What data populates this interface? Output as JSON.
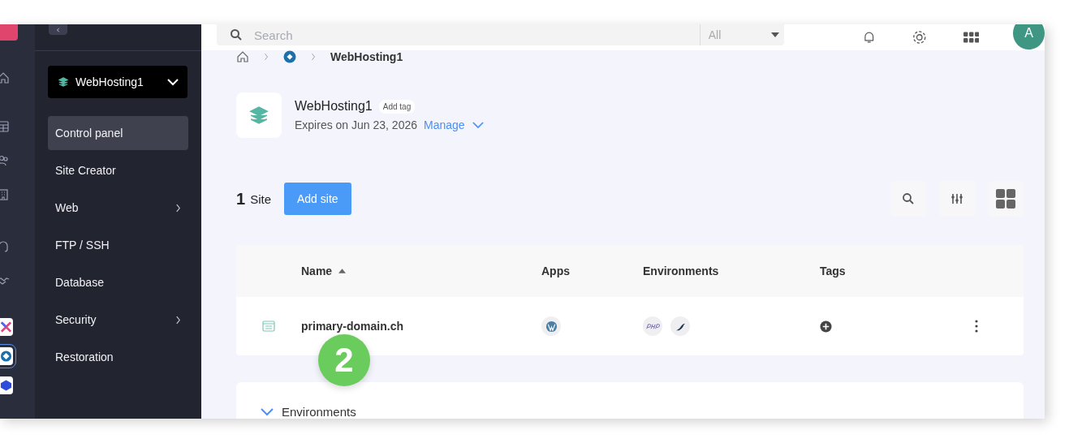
{
  "topbar": {
    "search": {
      "placeholder": "Search"
    },
    "scope": {
      "value": "All"
    },
    "avatar": "A"
  },
  "product_switcher": {
    "label": "WebHosting1"
  },
  "sidebar": {
    "items": [
      {
        "label": "Control panel",
        "selected": true,
        "has_submenu": false
      },
      {
        "label": "Site Creator",
        "selected": false,
        "has_submenu": false
      },
      {
        "label": "Web",
        "selected": false,
        "has_submenu": true
      },
      {
        "label": "FTP / SSH",
        "selected": false,
        "has_submenu": false
      },
      {
        "label": "Database",
        "selected": false,
        "has_submenu": false
      },
      {
        "label": "Security",
        "selected": false,
        "has_submenu": true
      },
      {
        "label": "Restoration",
        "selected": false,
        "has_submenu": false
      }
    ]
  },
  "breadcrumb": {
    "current": "WebHosting1"
  },
  "product": {
    "name": "WebHosting1",
    "tag_button": "Add tag",
    "expiry": "Expires on Jun 23, 2026",
    "manage": "Manage"
  },
  "sites": {
    "count": "1",
    "unit": "Site",
    "add_button": "Add site"
  },
  "table": {
    "columns": [
      {
        "label": "Name",
        "sorted": true
      },
      {
        "label": "Apps",
        "sorted": false
      },
      {
        "label": "Environments",
        "sorted": false
      },
      {
        "label": "Tags",
        "sorted": false
      }
    ],
    "rows": [
      {
        "name": "primary-domain.ch"
      }
    ]
  },
  "environments_section": {
    "title": "Environments",
    "expanded": true
  },
  "step_badge": "2"
}
